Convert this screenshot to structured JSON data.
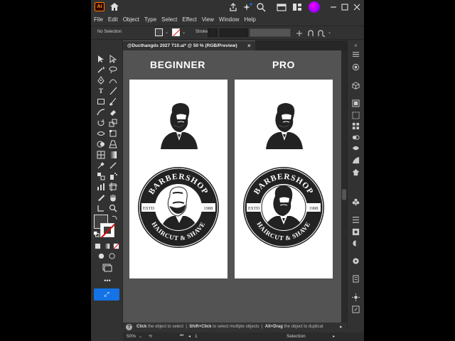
{
  "app": {
    "logo": "Ai",
    "menu": [
      "File",
      "Edit",
      "Object",
      "Type",
      "Select",
      "Effect",
      "View",
      "Window",
      "Help"
    ]
  },
  "control_bar": {
    "selection_label": "No Selection",
    "stroke_label": "Stroke:"
  },
  "document_tab": {
    "title": "@Ducthangds 2027 T10.ai* @ 50 % (RGB/Preview)",
    "close": "×"
  },
  "canvas": {
    "left_heading": "BEGINNER",
    "right_heading": "PRO",
    "badge_top_text": "BARBERSHOP",
    "badge_bottom_text": "HAIRCUT & SHAVE",
    "badge_left": "ESTD",
    "badge_right": "1988"
  },
  "hint_bar": {
    "part1_bold": "Click",
    "part1": " the object to select",
    "part2_bold": "Shift+Click",
    "part2": " to select multiple objects",
    "part3_bold": "Alt+Drag",
    "part3": " the object to duplicat"
  },
  "status_bar": {
    "zoom": "50%",
    "artboard_num": "1",
    "tool": "Selection"
  },
  "colors": {
    "accent": "#1473e6",
    "canvas_bg": "#535353",
    "panel_bg": "#323232"
  }
}
